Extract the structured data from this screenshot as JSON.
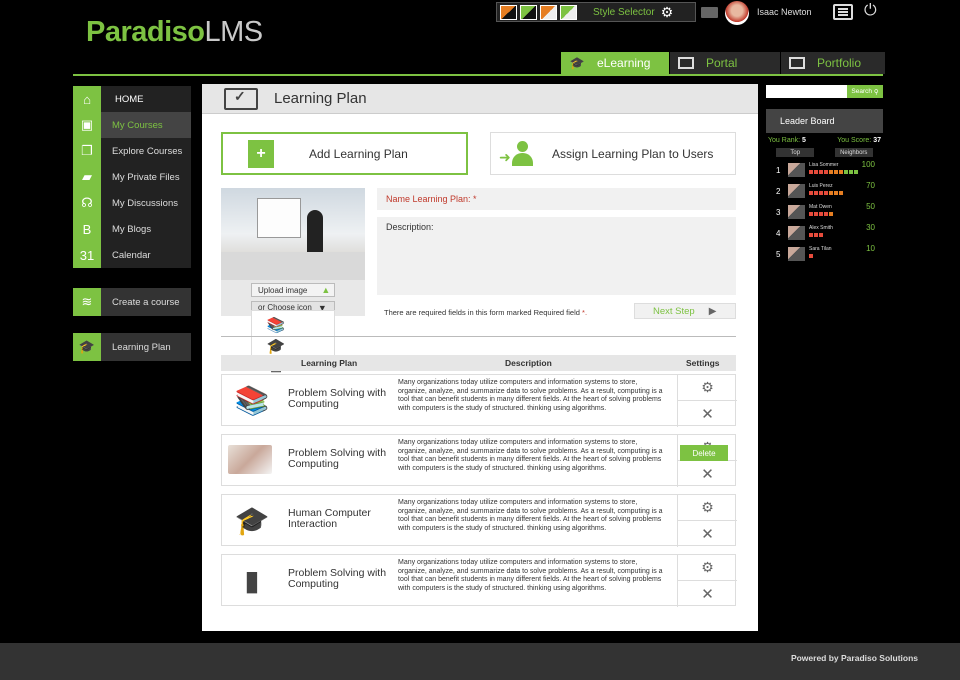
{
  "header": {
    "logo_main": "Paradiso",
    "logo_sub": "LMS",
    "style_selector_label": "Style Selector",
    "user_name": "Isaac Newton"
  },
  "tabs": [
    {
      "label": "eLearning",
      "active": true
    },
    {
      "label": "Portal",
      "active": false
    },
    {
      "label": "Portfolio",
      "active": false
    }
  ],
  "sidebar": {
    "items": [
      {
        "label": "HOME",
        "icon": "home-icon"
      },
      {
        "label": "My Courses",
        "icon": "courses-icon",
        "selected": true
      },
      {
        "label": "Explore Courses",
        "icon": "explore-icon"
      },
      {
        "label": "My Private Files",
        "icon": "folder-icon"
      },
      {
        "label": "My Discussions",
        "icon": "discussions-icon"
      },
      {
        "label": "My Blogs",
        "icon": "blog-icon"
      },
      {
        "label": "Calendar",
        "icon": "calendar-icon"
      }
    ],
    "create_course": "Create a course",
    "learning_plan": "Learning Plan"
  },
  "main": {
    "title": "Learning Plan",
    "add_button": "Add Learning Plan",
    "assign_button": "Assign Learning Plan to Users",
    "upload_image": "Upload image",
    "choose_icon": "or Choose icon",
    "name_label": "Name Learning Plan: *",
    "description_label": "Description:",
    "required_note": "There are required fields in this form marked Required field",
    "required_star": "*.",
    "next_step": "Next Step",
    "table": {
      "col_plan": "Learning Plan",
      "col_description": "Description",
      "col_settings": "Settings",
      "rows": [
        {
          "title": "Problem Solving with Computing",
          "icon": "books-icon",
          "description": "Many organizations today utilize computers and information systems to store, organize, analyze, and summarize data to solve problems. As a result, computing is a tool that can benefit students in many different fields. At the heart of solving problems with computers is the study of structured. thinking using algorithms."
        },
        {
          "title": "Problem Solving with Computing",
          "icon": "photo-thumbnail",
          "description": "Many organizations today utilize computers and information systems to store, organize, analyze, and summarize data to solve problems. As a result, computing is a tool that can benefit students in many different fields. At the heart of solving problems with computers is the study of structured. thinking using algorithms."
        },
        {
          "title": "Human Computer Interaction",
          "icon": "graduation-cap-icon",
          "description": "Many organizations today utilize computers and information systems to store, organize, analyze, and summarize data to solve problems. As a result, computing is a tool that can benefit students in many different fields. At the heart of solving problems with computers is the study of structured. thinking using algorithms."
        },
        {
          "title": "Problem Solving with Computing",
          "icon": "bookmark-book-icon",
          "description": "Many organizations today utilize computers and information systems to store, organize, analyze, and summarize data to solve problems. As a result, computing is a tool that can benefit students in many different fields. At the heart of solving problems with computers is the study of structured. thinking using algorithms."
        }
      ]
    },
    "delete_tooltip": "Delete"
  },
  "right": {
    "search_button": "Search",
    "leaderboard_title": "Leader Board",
    "your_rank_label": "You Rank:",
    "your_rank": "5",
    "your_score_label": "You Score:",
    "your_score": "37",
    "filter_top": "Top",
    "filter_neighbors": "Neighbors",
    "entries": [
      {
        "rank": "1",
        "name": "Lisa Sommer",
        "score": "100",
        "level": 10
      },
      {
        "rank": "2",
        "name": "Luis Perez",
        "score": "70",
        "level": 7
      },
      {
        "rank": "3",
        "name": "Mat Owen",
        "score": "50",
        "level": 5
      },
      {
        "rank": "4",
        "name": "Alex Smith",
        "score": "30",
        "level": 3
      },
      {
        "rank": "5",
        "name": "Sara Tilan",
        "score": "10",
        "level": 1
      }
    ]
  },
  "footer": {
    "text": "Powered by Paradiso Solutions"
  },
  "colors": {
    "accent": "#7dc242",
    "background": "#000000",
    "panel": "#ffffff",
    "alert": "#c0392b"
  }
}
